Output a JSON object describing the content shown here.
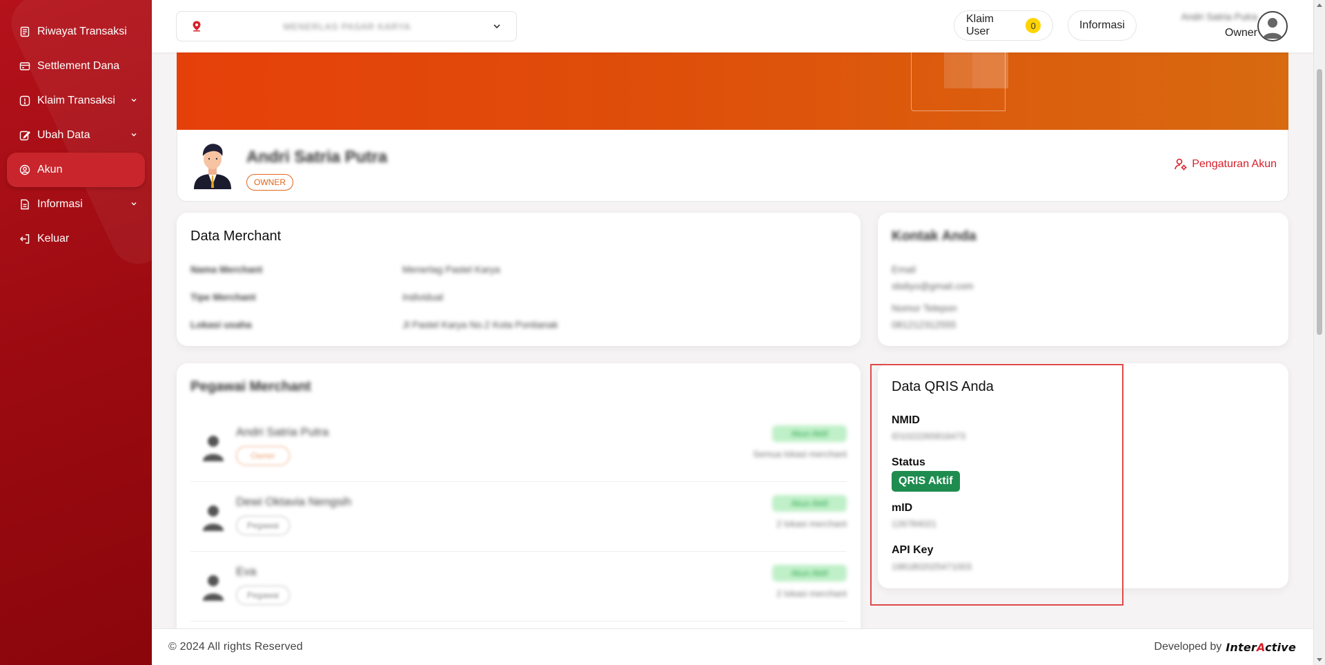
{
  "sidebar": {
    "items": [
      {
        "label": "Riwayat Transaksi",
        "icon": "receipt-icon"
      },
      {
        "label": "Settlement Dana",
        "icon": "wallet-icon"
      },
      {
        "label": "Klaim Transaksi",
        "icon": "alert-icon"
      },
      {
        "label": "Ubah Data",
        "icon": "edit-icon"
      },
      {
        "label": "Akun",
        "icon": "user-circle-icon",
        "active": true
      },
      {
        "label": "Informasi",
        "icon": "document-icon"
      },
      {
        "label": "Keluar",
        "icon": "logout-icon"
      }
    ]
  },
  "header": {
    "merchant_select_value": "MENERLAS PASAR KARYA",
    "klaim_user_label": "Klaim User",
    "klaim_user_count": "0",
    "informasi_label": "Informasi",
    "user_name": "Andri Satria Putra",
    "user_role": "Owner"
  },
  "profile": {
    "name": "Andri Satria Putra",
    "role_badge": "OWNER",
    "settings_label": "Pengaturan Akun"
  },
  "data_merchant": {
    "title": "Data Merchant",
    "rows": [
      {
        "key": "Nama Merchant",
        "value": "Menerlag Pastel Karya"
      },
      {
        "key": "Tipe Merchant",
        "value": "Individual"
      },
      {
        "key": "Lokasi usaha",
        "value": "Jl Pastel Karya No.2 Kota Pontianak"
      }
    ]
  },
  "kontak": {
    "title": "Kontak Anda",
    "email_label": "Email",
    "email_value": "sbdiyo@gmail.com",
    "phone_label": "Nomor Telepon",
    "phone_value": "081212312555"
  },
  "pegawai": {
    "title": "Pegawai Merchant",
    "rows": [
      {
        "name": "Andri Satria Putra",
        "role": "Owner",
        "status": "Akun Aktif",
        "info": "Semua lokasi merchant"
      },
      {
        "name": "Dewi Oktavia Nengsih",
        "role": "Pegawai",
        "status": "Akun Aktif",
        "info": "2 lokasi merchant"
      },
      {
        "name": "Eva",
        "role": "Pegawai",
        "status": "Akun Aktif",
        "info": "2 lokasi merchant"
      }
    ]
  },
  "qris": {
    "title": "Data QRIS Anda",
    "nmid_label": "NMID",
    "nmid_value": "ID1022265816473",
    "status_label": "Status",
    "status_value": "QRIS Aktif",
    "mid_label": "mID",
    "mid_value": "126784021",
    "api_key_label": "API Key",
    "api_key_value": "1981802025471003"
  },
  "footer": {
    "copyright": "© 2024 All rights Reserved",
    "developed_by": "Developed by",
    "logo_text_1": "Inter",
    "logo_text_a": "A",
    "logo_text_2": "ctive"
  },
  "colors": {
    "sidebar_bg": "#9a0a10",
    "accent_red": "#d6202a",
    "banner_orange": "#e6400a",
    "qris_green": "#1e8c4f",
    "highlight_red": "#e04848"
  }
}
